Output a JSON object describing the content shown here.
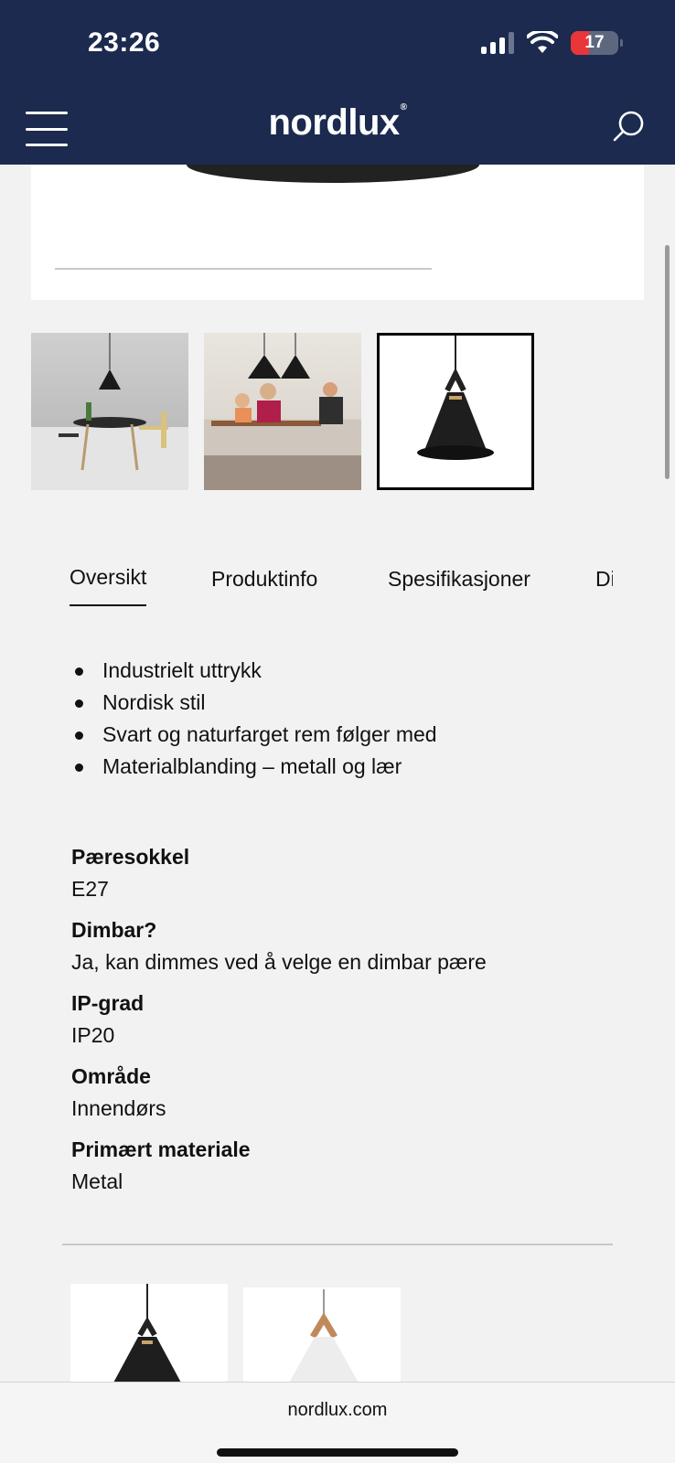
{
  "status_bar": {
    "time": "23:26",
    "battery": "17"
  },
  "header": {
    "brand": "nordlux",
    "brand_mark": "®"
  },
  "tabs": [
    {
      "label": "Oversikt",
      "active": true
    },
    {
      "label": "Produktinfo",
      "active": false
    },
    {
      "label": "Spesifikasjoner",
      "active": false
    },
    {
      "label": "Di",
      "active": false
    }
  ],
  "features": [
    "Industrielt uttrykk",
    "Nordisk stil",
    "Svart og naturfarget rem følger med",
    "Materialblanding – metall og lær"
  ],
  "specs": [
    {
      "label": "Pæresokkel",
      "value": "E27"
    },
    {
      "label": "Dimbar?",
      "value": "Ja, kan dimmes ved å velge en dimbar pære"
    },
    {
      "label": "IP-grad",
      "value": "IP20"
    },
    {
      "label": "Område",
      "value": "Innendørs"
    },
    {
      "label": "Primært materiale",
      "value": "Metal"
    }
  ],
  "browser": {
    "url": "nordlux.com"
  },
  "colors": {
    "header_bg": "#1b2a4e",
    "page_bg": "#f2f2f2"
  }
}
